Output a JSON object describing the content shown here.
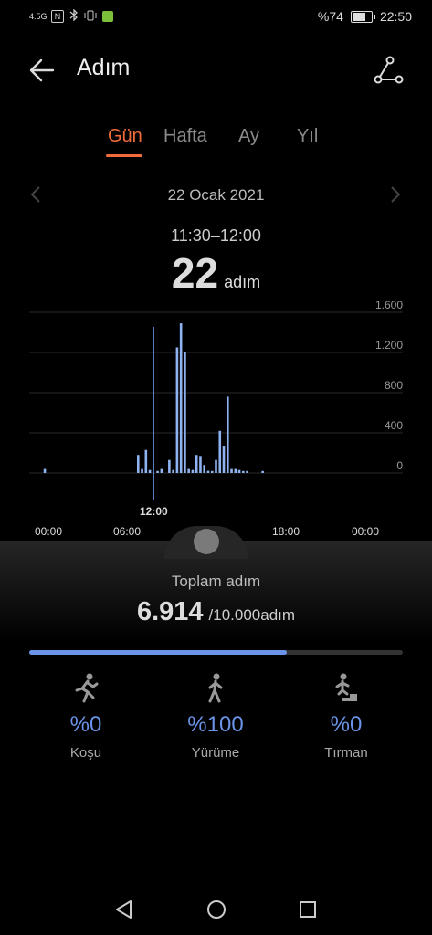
{
  "status": {
    "network": "4.5G",
    "battery": "%74",
    "battery_level": 0.74,
    "time": "22:50"
  },
  "header": {
    "title": "Adım"
  },
  "tabs": [
    {
      "label": "Gün",
      "active": true
    },
    {
      "label": "Hafta",
      "active": false
    },
    {
      "label": "Ay",
      "active": false
    },
    {
      "label": "Yıl",
      "active": false
    }
  ],
  "date": {
    "label": "22 Ocak 2021"
  },
  "selection": {
    "time_range": "11:30–12:00",
    "steps": "22",
    "unit": "adım",
    "cursor_label": "12:00"
  },
  "chart_data": {
    "type": "bar",
    "x_tick_labels": [
      "00:00",
      "06:00",
      "12:00",
      "18:00",
      "00:00"
    ],
    "y_tick_labels": [
      "1.600",
      "1.200",
      "800",
      "400",
      "0"
    ],
    "ylim": [
      0,
      1600
    ],
    "x_range_hours": [
      0,
      24
    ],
    "bars": [
      {
        "t": 1.0,
        "v": 40
      },
      {
        "t": 7.0,
        "v": 180
      },
      {
        "t": 7.25,
        "v": 40
      },
      {
        "t": 7.5,
        "v": 230
      },
      {
        "t": 7.75,
        "v": 30
      },
      {
        "t": 8.25,
        "v": 20
      },
      {
        "t": 8.5,
        "v": 40
      },
      {
        "t": 9.0,
        "v": 130
      },
      {
        "t": 9.25,
        "v": 30
      },
      {
        "t": 9.5,
        "v": 1250
      },
      {
        "t": 9.75,
        "v": 1490
      },
      {
        "t": 10.0,
        "v": 1200
      },
      {
        "t": 10.25,
        "v": 40
      },
      {
        "t": 10.5,
        "v": 30
      },
      {
        "t": 10.75,
        "v": 180
      },
      {
        "t": 11.0,
        "v": 170
      },
      {
        "t": 11.25,
        "v": 80
      },
      {
        "t": 11.5,
        "v": 22
      },
      {
        "t": 11.75,
        "v": 20
      },
      {
        "t": 12.0,
        "v": 130
      },
      {
        "t": 12.25,
        "v": 420
      },
      {
        "t": 12.5,
        "v": 270
      },
      {
        "t": 12.75,
        "v": 760
      },
      {
        "t": 13.0,
        "v": 40
      },
      {
        "t": 13.25,
        "v": 40
      },
      {
        "t": 13.5,
        "v": 30
      },
      {
        "t": 13.75,
        "v": 20
      },
      {
        "t": 14.0,
        "v": 20
      },
      {
        "t": 15.0,
        "v": 20
      }
    ],
    "cursor_time": 8.0
  },
  "summary": {
    "label": "Toplam adım",
    "total": "6.914",
    "goal": "/10.000adım",
    "progress": 0.69
  },
  "activities": [
    {
      "icon": "running-icon",
      "pct": "%0",
      "label": "Koşu"
    },
    {
      "icon": "walking-icon",
      "pct": "%100",
      "label": "Yürüme"
    },
    {
      "icon": "climbing-icon",
      "pct": "%0",
      "label": "Tırman"
    }
  ],
  "colors": {
    "accent": "#f26b3a",
    "bar": "#8fb2f0",
    "progress": "#6b93e8",
    "text_secondary": "#bbbbbb"
  }
}
